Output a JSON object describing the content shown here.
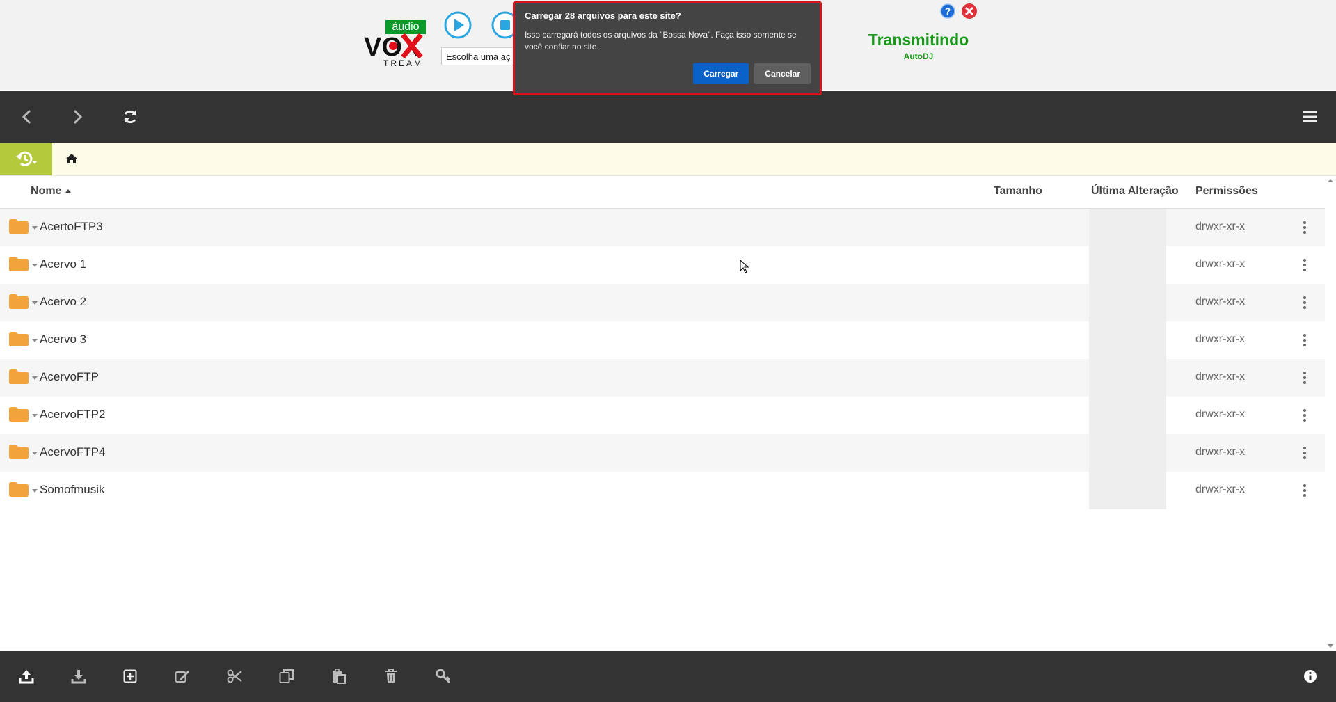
{
  "header": {
    "audio_badge": "áudio",
    "logo_text": "VOX",
    "logo_sub": "TREAM",
    "action_select_value": "Escolha uma aç",
    "status_title": "Transmitindo",
    "status_sub": "AutoDJ"
  },
  "dialog": {
    "title": "Carregar 28 arquivos para este site?",
    "text": "Isso carregará todos os arquivos da \"Bossa Nova\". Faça isso somente se você confiar no site.",
    "confirm_label": "Carregar",
    "cancel_label": "Cancelar"
  },
  "table": {
    "columns": [
      "Nome",
      "Tamanho",
      "Última Alteração",
      "Permissões"
    ],
    "rows": [
      {
        "name": "AcertoFTP3",
        "size": "",
        "perms": "drwxr-xr-x"
      },
      {
        "name": "Acervo 1",
        "size": "",
        "perms": "drwxr-xr-x"
      },
      {
        "name": "Acervo 2",
        "size": "",
        "perms": "drwxr-xr-x"
      },
      {
        "name": "Acervo 3",
        "size": "",
        "perms": "drwxr-xr-x"
      },
      {
        "name": "AcervoFTP",
        "size": "",
        "perms": "drwxr-xr-x"
      },
      {
        "name": "AcervoFTP2",
        "size": "",
        "perms": "drwxr-xr-x"
      },
      {
        "name": "AcervoFTP4",
        "size": "",
        "perms": "drwxr-xr-x"
      },
      {
        "name": "Somofmusik",
        "size": "",
        "perms": "drwxr-xr-x"
      }
    ]
  },
  "colors": {
    "header_bg": "#f2f2f2",
    "toolbar_bg": "#333333",
    "dialog_border": "#e0101a",
    "primary_button": "#0a62c9",
    "status_green": "#1a9a1a",
    "folder_orange": "#f3a33b",
    "history_green": "#b5c93c"
  },
  "icons": {
    "toolbar": [
      "arrow-left-icon",
      "arrow-right-icon",
      "refresh-icon",
      "hamburger-menu-icon"
    ],
    "bottom": [
      "upload-icon",
      "download-icon",
      "new-folder-icon",
      "edit-icon",
      "cut-icon",
      "copy-icon",
      "paste-icon",
      "trash-icon",
      "permissions-key-icon",
      "info-icon"
    ]
  }
}
